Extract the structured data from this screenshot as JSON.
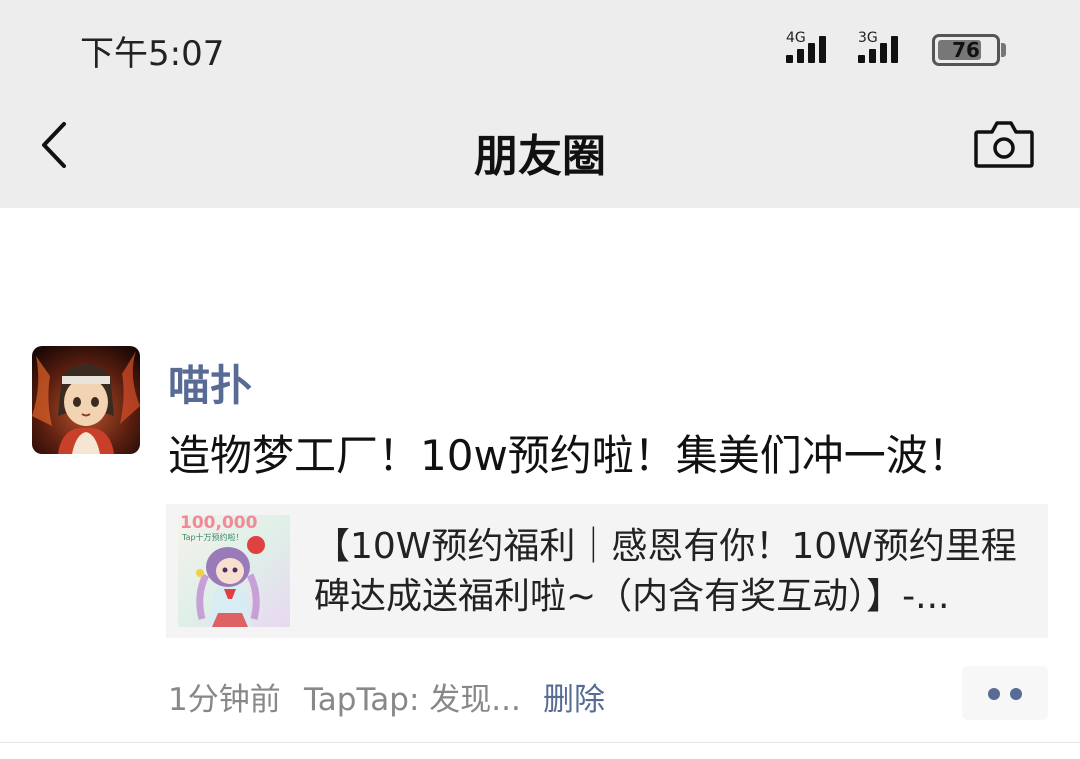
{
  "status_bar": {
    "time": "下午5:07",
    "signal_1": {
      "label": "4G",
      "bars": 4
    },
    "signal_2": {
      "label": "3G",
      "bars": 4
    },
    "battery_level": "76",
    "battery_fraction": 0.76
  },
  "nav": {
    "title": "朋友圈",
    "back_icon": "chevron-left-icon",
    "camera_icon": "camera-icon"
  },
  "post": {
    "username": "喵扑",
    "text": "造物梦工厂！10w预约啦！集美们冲一波！",
    "link_card": {
      "thumbnail_text": "100,000",
      "thumbnail_caption": "Tap十万预约啦！",
      "title": "【10W预约福利｜感恩有你！10W预约里程碑达成送福利啦~（内含有奖互动）】-..."
    },
    "time": "1分钟前",
    "source": "TapTap: 发现...",
    "delete_label": "删除",
    "more_icon": "more-dots-icon"
  },
  "colors": {
    "accent": "#576b95",
    "header_bg": "#ededed",
    "card_bg": "#f4f4f4"
  }
}
